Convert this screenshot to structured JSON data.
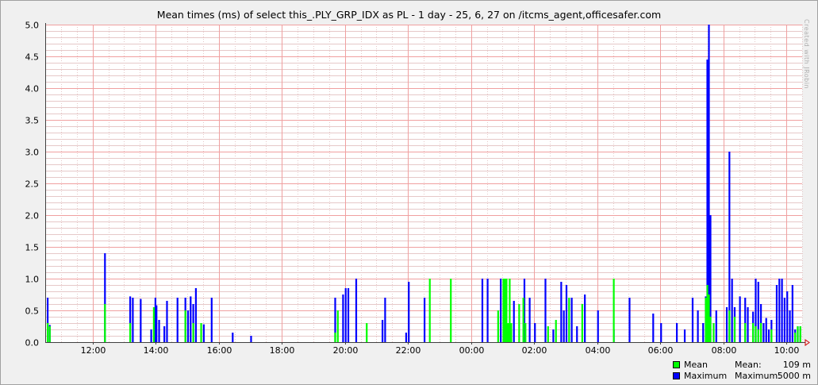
{
  "chart_data": {
    "type": "bar",
    "title": "Mean times (ms) of select this_.PLY_GRP_IDX as PL - 1 day - 25, 6, 27 on /itcms_agent,officesafer.com",
    "watermark": "Created with JRobin",
    "xlabel": "",
    "ylabel": "",
    "x_range": [
      "10:30",
      "10:30"
    ],
    "ylim": [
      0,
      5.0
    ],
    "y_ticks": [
      "0.0",
      "0.5",
      "1.0",
      "1.5",
      "2.0",
      "2.5",
      "3.0",
      "3.5",
      "4.0",
      "4.5",
      "5.0"
    ],
    "x_ticks": [
      "12:00",
      "14:00",
      "16:00",
      "18:00",
      "20:00",
      "22:00",
      "00:00",
      "02:00",
      "04:00",
      "06:00",
      "08:00",
      "10:00"
    ],
    "grid": true,
    "legend_position": "bottom-right",
    "colors": {
      "mean": "#00ff00",
      "maximum": "#0000ff",
      "major_grid": "#f0a0a0",
      "minor_grid": "#e6c8c8",
      "axis": "#404040",
      "background": "#ffffff"
    },
    "series": [
      {
        "name": "Mean",
        "stat_label": "Mean:",
        "stat_value": "109 m",
        "points": [
          [
            "10:33",
            0.3
          ],
          [
            "10:37",
            0.25
          ],
          [
            "12:22",
            0.6
          ],
          [
            "13:10",
            0.3
          ],
          [
            "13:55",
            0.55
          ],
          [
            "14:55",
            0.5
          ],
          [
            "15:10",
            0.3
          ],
          [
            "15:25",
            0.3
          ],
          [
            "19:45",
            0.5
          ],
          [
            "19:40",
            0.15
          ],
          [
            "20:40",
            0.3
          ],
          [
            "22:40",
            1.0
          ],
          [
            "23:20",
            1.0
          ],
          [
            "00:50",
            0.5
          ],
          [
            "01:00",
            1.0
          ],
          [
            "01:03",
            1.0
          ],
          [
            "01:06",
            1.0
          ],
          [
            "01:09",
            0.3
          ],
          [
            "01:12",
            1.0
          ],
          [
            "01:15",
            0.3
          ],
          [
            "01:30",
            0.6
          ],
          [
            "01:38",
            0.7
          ],
          [
            "01:42",
            0.3
          ],
          [
            "02:25",
            0.25
          ],
          [
            "02:40",
            0.35
          ],
          [
            "03:05",
            0.7
          ],
          [
            "03:30",
            0.6
          ],
          [
            "04:30",
            1.0
          ],
          [
            "07:25",
            0.7
          ],
          [
            "07:28",
            0.9
          ],
          [
            "07:31",
            0.75
          ],
          [
            "07:34",
            0.4
          ],
          [
            "07:40",
            0.3
          ],
          [
            "08:10",
            0.5
          ],
          [
            "08:20",
            0.4
          ],
          [
            "08:40",
            0.3
          ],
          [
            "08:55",
            0.3
          ],
          [
            "09:00",
            0.25
          ],
          [
            "09:05",
            0.2
          ],
          [
            "09:10",
            0.3
          ],
          [
            "09:30",
            0.2
          ],
          [
            "10:15",
            0.15
          ],
          [
            "10:20",
            0.25
          ],
          [
            "10:25",
            0.25
          ]
        ]
      },
      {
        "name": "Maximum",
        "stat_label": "Maximum:",
        "stat_value": "5000 m",
        "points": [
          [
            "10:33",
            0.7
          ],
          [
            "10:37",
            0.27
          ],
          [
            "12:22",
            1.4
          ],
          [
            "13:10",
            0.72
          ],
          [
            "13:15",
            0.7
          ],
          [
            "13:30",
            0.68
          ],
          [
            "13:50",
            0.2
          ],
          [
            "13:58",
            0.7
          ],
          [
            "14:00",
            0.58
          ],
          [
            "14:05",
            0.35
          ],
          [
            "14:15",
            0.25
          ],
          [
            "14:20",
            0.65
          ],
          [
            "14:40",
            0.7
          ],
          [
            "14:55",
            0.7
          ],
          [
            "15:00",
            0.5
          ],
          [
            "15:05",
            0.72
          ],
          [
            "15:10",
            0.6
          ],
          [
            "15:15",
            0.85
          ],
          [
            "15:30",
            0.28
          ],
          [
            "15:45",
            0.7
          ],
          [
            "16:25",
            0.15
          ],
          [
            "17:00",
            0.1
          ],
          [
            "19:40",
            0.7
          ],
          [
            "19:55",
            0.75
          ],
          [
            "20:00",
            0.85
          ],
          [
            "20:05",
            0.85
          ],
          [
            "20:20",
            1.0
          ],
          [
            "21:10",
            0.35
          ],
          [
            "21:15",
            0.7
          ],
          [
            "21:55",
            0.15
          ],
          [
            "22:00",
            0.95
          ],
          [
            "22:30",
            0.7
          ],
          [
            "00:20",
            1.0
          ],
          [
            "00:30",
            1.0
          ],
          [
            "00:55",
            1.0
          ],
          [
            "01:05",
            1.0
          ],
          [
            "01:10",
            0.3
          ],
          [
            "01:20",
            0.65
          ],
          [
            "01:40",
            1.0
          ],
          [
            "01:50",
            0.7
          ],
          [
            "02:00",
            0.3
          ],
          [
            "02:20",
            1.0
          ],
          [
            "02:35",
            0.2
          ],
          [
            "02:50",
            0.95
          ],
          [
            "02:55",
            0.5
          ],
          [
            "03:00",
            0.9
          ],
          [
            "03:10",
            0.7
          ],
          [
            "03:20",
            0.25
          ],
          [
            "03:35",
            0.75
          ],
          [
            "04:00",
            0.5
          ],
          [
            "04:30",
            0.2
          ],
          [
            "05:00",
            0.7
          ],
          [
            "05:45",
            0.45
          ],
          [
            "06:00",
            0.3
          ],
          [
            "06:30",
            0.3
          ],
          [
            "06:45",
            0.2
          ],
          [
            "07:00",
            0.7
          ],
          [
            "07:10",
            0.5
          ],
          [
            "07:20",
            0.3
          ],
          [
            "07:25",
            0.72
          ],
          [
            "07:28",
            4.45
          ],
          [
            "07:31",
            5.0
          ],
          [
            "07:34",
            2.0
          ],
          [
            "07:45",
            0.5
          ],
          [
            "08:05",
            0.55
          ],
          [
            "08:10",
            3.0
          ],
          [
            "08:15",
            1.0
          ],
          [
            "08:20",
            0.55
          ],
          [
            "08:30",
            0.72
          ],
          [
            "08:40",
            0.7
          ],
          [
            "08:45",
            0.55
          ],
          [
            "08:55",
            0.48
          ],
          [
            "09:00",
            1.0
          ],
          [
            "09:05",
            0.95
          ],
          [
            "09:10",
            0.6
          ],
          [
            "09:15",
            0.3
          ],
          [
            "09:20",
            0.38
          ],
          [
            "09:25",
            0.2
          ],
          [
            "09:30",
            0.35
          ],
          [
            "09:40",
            0.9
          ],
          [
            "09:45",
            1.0
          ],
          [
            "09:50",
            1.0
          ],
          [
            "09:55",
            0.7
          ],
          [
            "10:00",
            0.8
          ],
          [
            "10:05",
            0.5
          ],
          [
            "10:10",
            0.9
          ],
          [
            "10:15",
            0.2
          ],
          [
            "10:20",
            0.25
          ],
          [
            "10:25",
            0.25
          ]
        ]
      }
    ]
  }
}
